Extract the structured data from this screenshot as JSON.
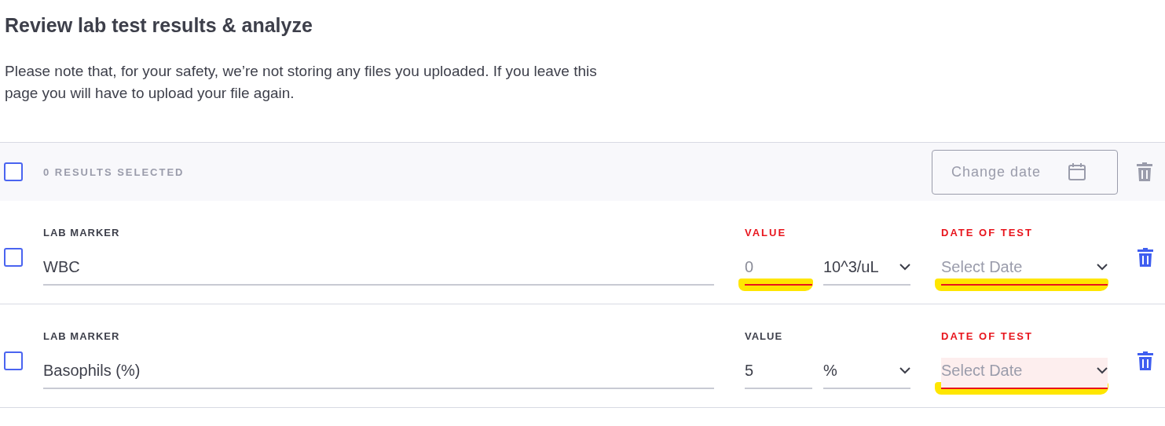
{
  "title": "Review lab test results & analyze",
  "notice": "Please note that, for your safety, we’re not storing any files you uploaded. If you leave this page you will have to upload your file again.",
  "toolbar": {
    "select_all_checked": false,
    "selection_count": "0 RESULTS SELECTED",
    "change_date": {
      "label": "Change date",
      "disabled": true
    },
    "delete_disabled": true
  },
  "rows": [
    {
      "checked": false,
      "marker_label": "LAB MARKER",
      "marker": "WBC",
      "value_label": "VALUE",
      "value": "0",
      "value_error": true,
      "value_highlighted": true,
      "unit": "10^3/uL",
      "date_label": "DATE OF TEST",
      "date_placeholder": "Select Date",
      "date_error": true,
      "date_highlighted": true,
      "date_focused": false
    },
    {
      "checked": false,
      "marker_label": "LAB MARKER",
      "marker": "Basophils (%)",
      "value_label": "VALUE",
      "value": "5",
      "value_error": false,
      "value_highlighted": false,
      "unit": "%",
      "date_label": "DATE OF TEST",
      "date_placeholder": "Select Date",
      "date_error": true,
      "date_highlighted": true,
      "date_focused": true
    }
  ]
}
